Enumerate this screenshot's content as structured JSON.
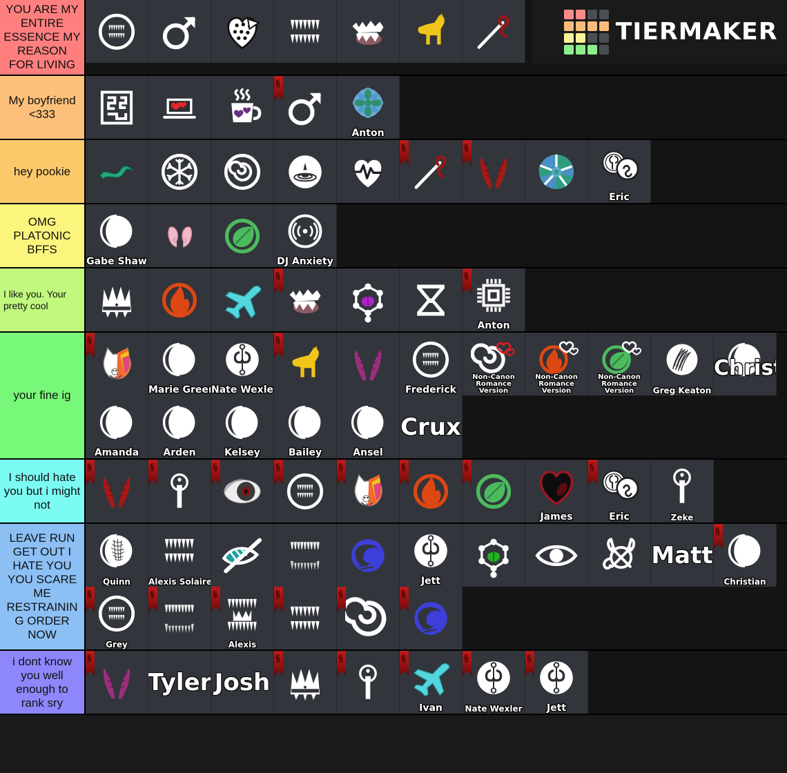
{
  "brand": {
    "name": "TIERMAKER",
    "logo_colors": [
      "#f98a8a",
      "#f98a8a",
      "#4a4d52",
      "#4a4d52",
      "#f9bc7c",
      "#f9bc7c",
      "#f9bc7c",
      "#f9bc7c",
      "#f7f396",
      "#f7f396",
      "#4a4d52",
      "#4a4d52",
      "#8cef8c",
      "#8cef8c",
      "#8cef8c",
      "#4a4d52"
    ]
  },
  "tiers": [
    {
      "label": "YOU ARE MY ENTIRE ESSENCE MY REASON FOR LIVING",
      "color": "#ff7f7f",
      "label_style": "center",
      "items": [
        {
          "icon": "fanged-mouth-circle-icon",
          "caption": ""
        },
        {
          "icon": "mars-symbol-icon",
          "caption": ""
        },
        {
          "icon": "cookie-heart-icon",
          "caption": ""
        },
        {
          "icon": "fangs-icon",
          "caption": ""
        },
        {
          "icon": "snarling-jaws-icon",
          "caption": ""
        },
        {
          "icon": "howling-wolf-icon",
          "caption": ""
        },
        {
          "icon": "needle-thread-icon",
          "caption": ""
        }
      ]
    },
    {
      "label": "My boyfriend <333",
      "color": "#fcc07a",
      "label_style": "center",
      "items": [
        {
          "icon": "maze-icon",
          "caption": ""
        },
        {
          "icon": "laptop-hearts-icon",
          "caption": ""
        },
        {
          "icon": "hearts-mug-icon",
          "caption": ""
        },
        {
          "icon": "mars-symbol-icon",
          "caption": "",
          "ribbon": true
        },
        {
          "icon": "anton-flower-icon",
          "caption": "Anton"
        }
      ]
    },
    {
      "label": "hey pookie",
      "color": "#fbc96a",
      "label_style": "center",
      "items": [
        {
          "icon": "green-tentacle-icon",
          "caption": ""
        },
        {
          "icon": "snowflake-circle-icon",
          "caption": ""
        },
        {
          "icon": "spiral-circle-icon",
          "caption": ""
        },
        {
          "icon": "water-drop-circle-icon",
          "caption": ""
        },
        {
          "icon": "heartbeat-brain-icon",
          "caption": ""
        },
        {
          "icon": "needle-thread-icon",
          "caption": "",
          "ribbon": true
        },
        {
          "icon": "red-horns-icon",
          "caption": "",
          "ribbon": true
        },
        {
          "icon": "teal-aperture-icon",
          "caption": ""
        },
        {
          "icon": "eric-badge-icon",
          "caption": "Eric"
        }
      ]
    },
    {
      "label": "OMG PLATONIC BFFS",
      "color": "#fbf57d",
      "label_style": "center",
      "items": [
        {
          "icon": "moon-phase-icon",
          "caption": "Gabe Shaw"
        },
        {
          "icon": "pink-horns-icon",
          "caption": ""
        },
        {
          "icon": "green-leaf-circle-icon",
          "caption": ""
        },
        {
          "icon": "radio-waves-circle-icon",
          "caption": "DJ Anxiety"
        }
      ]
    },
    {
      "label": "I like you. Your pretty cool",
      "color": "#c1f87d",
      "label_style": "left-small",
      "items": [
        {
          "icon": "spiked-crown-icon",
          "caption": ""
        },
        {
          "icon": "orange-flame-circle-icon",
          "caption": ""
        },
        {
          "icon": "cyan-airplane-icon",
          "caption": ""
        },
        {
          "icon": "snarling-jaws-icon",
          "caption": "",
          "ribbon": true
        },
        {
          "icon": "purple-brain-network-icon",
          "caption": ""
        },
        {
          "icon": "hourglass-icon",
          "caption": ""
        },
        {
          "icon": "cpu-chip-icon",
          "caption": "Anton",
          "ribbon": true
        }
      ]
    },
    {
      "label": "your fine ig",
      "color": "#78f878",
      "label_style": "center",
      "items": [
        {
          "icon": "rainbow-dog-icon",
          "caption": "",
          "ribbon": true
        },
        {
          "icon": "moon-phase-icon",
          "caption": "Marie Greer"
        },
        {
          "icon": "jp-monogram-circle-icon",
          "caption": "Nate Wexler"
        },
        {
          "icon": "howling-wolf-icon",
          "caption": "",
          "ribbon": true
        },
        {
          "icon": "purple-horns-icon",
          "caption": ""
        },
        {
          "icon": "fanged-mouth-circle-icon",
          "caption": "Frederick"
        },
        {
          "icon": "spiral-romance-icon",
          "caption": "Non-Canon Romance Version",
          "caption_size": "tiny"
        },
        {
          "icon": "flame-romance-icon",
          "caption": "Non-Canon Romance Version",
          "caption_size": "tiny"
        },
        {
          "icon": "leaf-romance-icon",
          "caption": "Non-Canon Romance Version",
          "caption_size": "tiny"
        },
        {
          "icon": "claw-scratch-circle-icon",
          "caption": "Greg Keaton",
          "caption_size": "mid"
        },
        {
          "icon": "moon-phase-icon",
          "caption": "Christian",
          "caption_size": "big"
        },
        {
          "icon": "moon-phase-icon",
          "caption": "Amanda"
        },
        {
          "icon": "moon-phase-icon",
          "caption": "Arden"
        },
        {
          "icon": "moon-phase-icon",
          "caption": "Kelsey"
        },
        {
          "icon": "moon-phase-icon",
          "caption": "Bailey"
        },
        {
          "icon": "moon-phase-icon",
          "caption": "Ansel"
        },
        {
          "icon": "text-only-icon",
          "caption": "",
          "text": "Crux"
        }
      ]
    },
    {
      "label": "I should hate you but i might not",
      "color": "#7cfbf3",
      "label_style": "center",
      "items": [
        {
          "icon": "red-horns-icon",
          "caption": "",
          "ribbon": true
        },
        {
          "icon": "sword-ring-icon",
          "caption": "",
          "ribbon": true
        },
        {
          "icon": "red-eye-icon",
          "caption": "",
          "ribbon": true
        },
        {
          "icon": "fanged-mouth-circle-icon",
          "caption": "",
          "ribbon": true
        },
        {
          "icon": "rainbow-dog-icon",
          "caption": "",
          "ribbon": true
        },
        {
          "icon": "orange-flame-circle-icon",
          "caption": "",
          "ribbon": true
        },
        {
          "icon": "green-leaf-circle-icon",
          "caption": "",
          "ribbon": true
        },
        {
          "icon": "black-red-heart-icon",
          "caption": "James"
        },
        {
          "icon": "eric-badge-icon",
          "caption": "Eric",
          "ribbon": true
        },
        {
          "icon": "sword-ring-icon",
          "caption": "Zeke",
          "caption_size": "mid"
        }
      ]
    },
    {
      "label": "LEAVE RUN GET OUT I HATE YOU YOU SCARE ME RESTRAINING ORDER NOW",
      "color": "#8cc0f5",
      "label_style": "center",
      "items": [
        {
          "icon": "scribble-moon-icon",
          "caption": "Quinn",
          "caption_size": "mid"
        },
        {
          "icon": "fangs-icon",
          "caption": "Alexis Solaire",
          "caption_size": "mid"
        },
        {
          "icon": "teal-eye-slash-icon",
          "caption": ""
        },
        {
          "icon": "scratchy-fangs-icon",
          "caption": ""
        },
        {
          "icon": "blue-wave-circle-icon",
          "caption": ""
        },
        {
          "icon": "jp-monogram-circle-icon",
          "caption": "Jett"
        },
        {
          "icon": "green-brain-network-icon",
          "caption": ""
        },
        {
          "icon": "eye-icon",
          "caption": ""
        },
        {
          "icon": "horned-knot-icon",
          "caption": ""
        },
        {
          "icon": "text-only-icon",
          "caption": "",
          "text": "Matt"
        },
        {
          "icon": "moon-phase-icon",
          "caption": "Christian",
          "caption_size": "mid",
          "ribbon": true
        },
        {
          "icon": "fanged-mouth-circle-icon",
          "caption": "Grey",
          "caption_size": "mid",
          "ribbon": true
        },
        {
          "icon": "scratchy-fangs-icon",
          "caption": "",
          "ribbon": true
        },
        {
          "icon": "crowned-fangs-icon",
          "caption": "Alexis",
          "caption_size": "mid",
          "ribbon": true
        },
        {
          "icon": "fangs-icon",
          "caption": "",
          "ribbon": true
        },
        {
          "icon": "spiral-icon",
          "caption": "",
          "ribbon": true
        },
        {
          "icon": "blue-wave-circle-icon",
          "caption": "",
          "ribbon": true
        }
      ]
    },
    {
      "label": "i dont know you well enough to rank sry",
      "color": "#8e87fb",
      "label_style": "center",
      "items": [
        {
          "icon": "purple-horns-icon",
          "caption": "",
          "ribbon": true
        },
        {
          "icon": "text-only-icon",
          "caption": "",
          "text": "Tyler"
        },
        {
          "icon": "text-only-icon",
          "caption": "",
          "text": "Josh"
        },
        {
          "icon": "spiked-crown-icon",
          "caption": "",
          "ribbon": true
        },
        {
          "icon": "sword-ring-icon",
          "caption": "",
          "ribbon": true
        },
        {
          "icon": "cyan-airplane-icon",
          "caption": "Ivan",
          "ribbon": true
        },
        {
          "icon": "jp-monogram-circle-icon",
          "caption": "Nate Wexler",
          "caption_size": "mid",
          "ribbon": true
        },
        {
          "icon": "jp-monogram-circle-icon",
          "caption": "Jett",
          "ribbon": true
        }
      ]
    }
  ]
}
